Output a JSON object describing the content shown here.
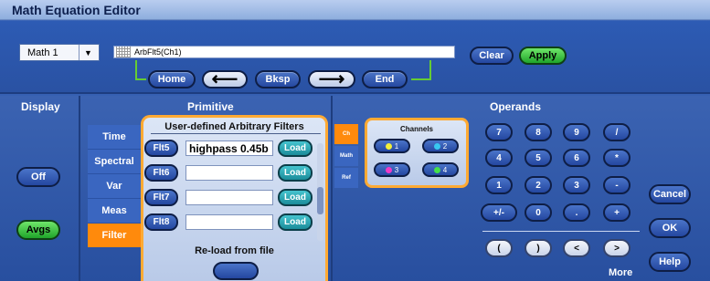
{
  "window": {
    "title": "Math Equation Editor"
  },
  "top": {
    "math_select": {
      "value": "Math 1",
      "arrow": "▼"
    },
    "expression": "ArbFlt5(Ch1)",
    "nav": {
      "home": "Home",
      "left_arrow": "⟵",
      "bksp": "Bksp",
      "right_arrow": "⟶",
      "end": "End"
    },
    "clear": "Clear",
    "apply": "Apply"
  },
  "display": {
    "label": "Display",
    "off": "Off",
    "avgs": "Avgs"
  },
  "primitive": {
    "label": "Primitive",
    "tabs": [
      "Time",
      "Spectral",
      "Var",
      "Meas",
      "Filter"
    ],
    "active_tab": "Filter",
    "filters_title": "User-defined Arbitrary Filters",
    "filters": [
      {
        "name": "Flt5",
        "value": "highpass  0.45b",
        "load": "Load"
      },
      {
        "name": "Flt6",
        "value": "",
        "load": "Load"
      },
      {
        "name": "Flt7",
        "value": "",
        "load": "Load"
      },
      {
        "name": "Flt8",
        "value": "",
        "load": "Load"
      }
    ],
    "reload_label": "Re-load from file"
  },
  "operands": {
    "label": "Operands",
    "tabs": [
      "Ch",
      "Math",
      "Ref"
    ],
    "active_tab": "Ch",
    "channels_title": "Channels",
    "channels": [
      {
        "label": "1",
        "color": "#f2ef3a"
      },
      {
        "label": "2",
        "color": "#38c8f0"
      },
      {
        "label": "3",
        "color": "#f03ac8"
      },
      {
        "label": "4",
        "color": "#44e04a"
      }
    ],
    "keypad": {
      "row1": [
        "7",
        "8",
        "9",
        "/"
      ],
      "row2": [
        "4",
        "5",
        "6",
        "*"
      ],
      "row3": [
        "1",
        "2",
        "3",
        "-"
      ],
      "row4": [
        "+/-",
        "0",
        ".",
        "+"
      ],
      "row5": [
        "(",
        ")",
        "<",
        ">"
      ]
    },
    "more": "More"
  },
  "right": {
    "cancel": "Cancel",
    "ok": "OK",
    "help": "Help"
  }
}
